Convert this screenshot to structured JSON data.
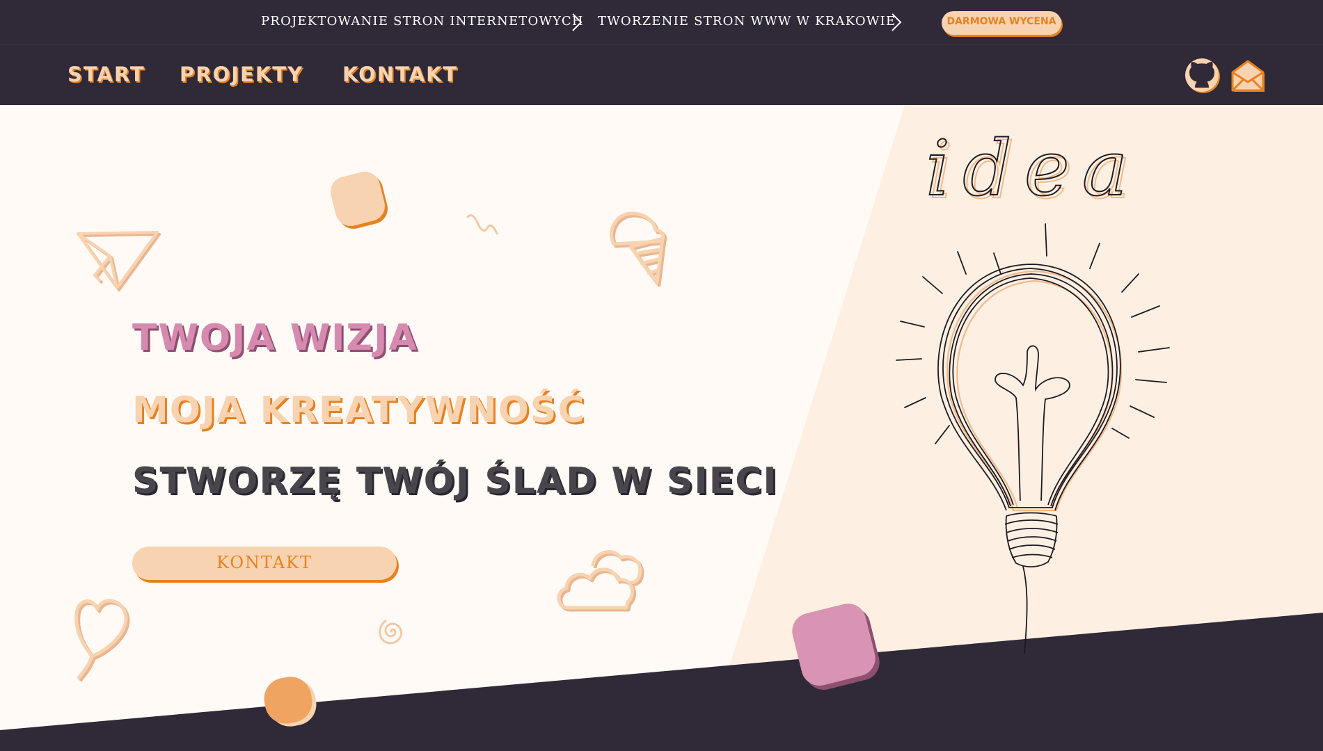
{
  "topbar": {
    "crumb_1": "PROJEKTOWANIE STRON INTERNETOWYCH",
    "crumb_2": "TWORZENIE STRON WWW W KRAKOWIE",
    "quote_button": "DARMOWA WYCENA"
  },
  "nav": {
    "items": [
      {
        "label": "START"
      },
      {
        "label": "PROJEKTY"
      },
      {
        "label": "KONTAKT"
      }
    ],
    "icons": [
      "github-icon",
      "envelope-icon"
    ]
  },
  "hero": {
    "line_1": "TWOJA WIZJA",
    "line_2": "MOJA KREATYWNOŚĆ",
    "line_3": "STWORZĘ TWÓJ ŚLAD W SIECI",
    "cta_label": "KONTAKT",
    "illustration": {
      "word": "idea",
      "icon": "lightbulb-icon"
    }
  },
  "colors": {
    "dark": "#2f2938",
    "peach": "#f8d3b1",
    "orange": "#e8811f",
    "pink": "#d68ab0",
    "cream": "#fffaf5",
    "light_peach": "#fdf0e3",
    "text_dark": "#48454c"
  },
  "decorations": [
    "paper-plane-icon",
    "rounded-square",
    "squiggle",
    "ice-cream-icon",
    "heart-balloon-icon",
    "spiral-icon",
    "cloud-icon",
    "circle-blob",
    "pink-rounded-square"
  ]
}
